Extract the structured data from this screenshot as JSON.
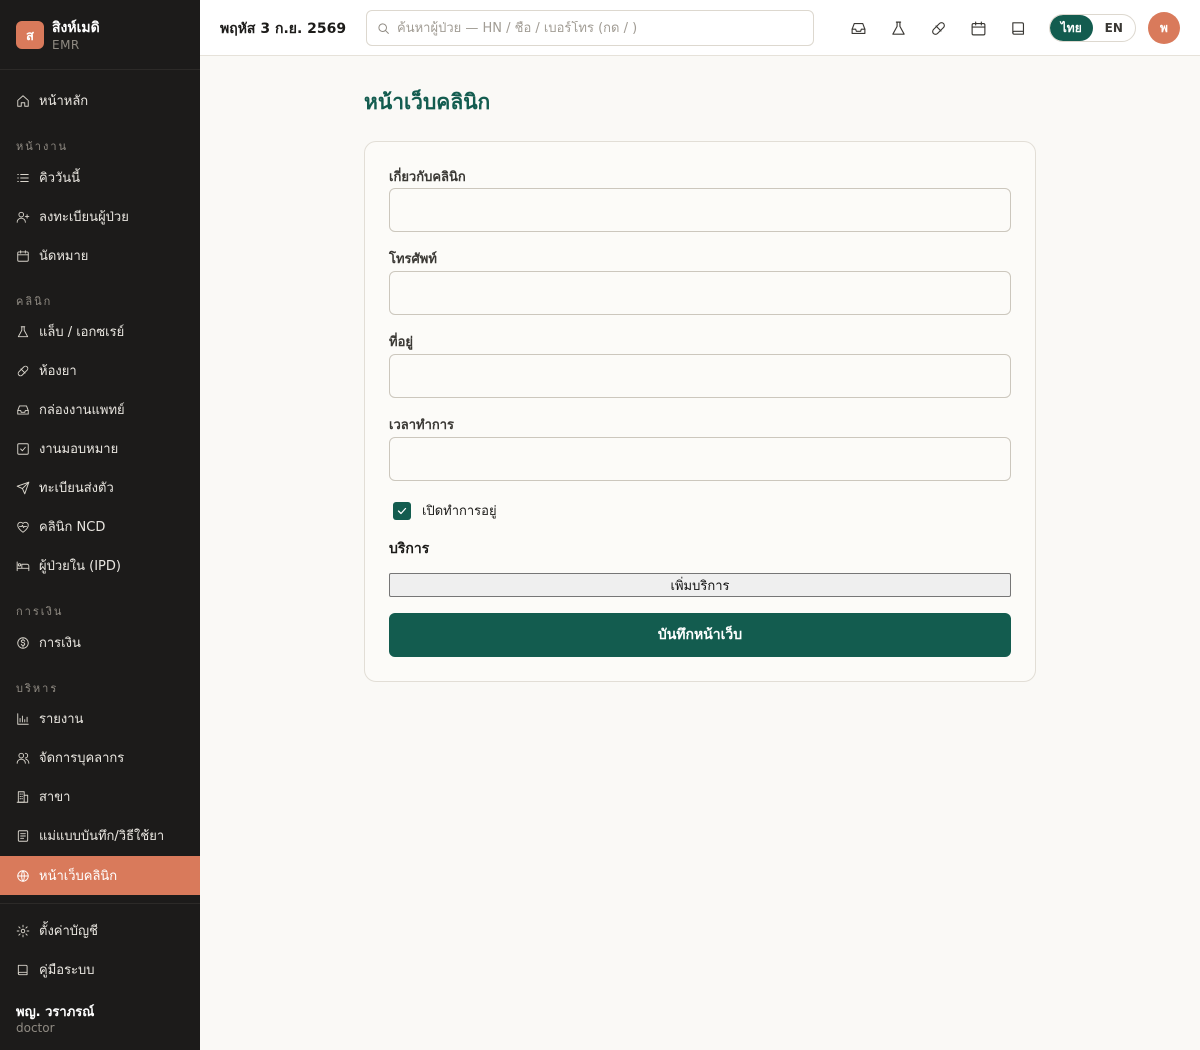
{
  "brand": {
    "logo_letter": "ส",
    "name": "สิงห์เมดิ",
    "subtitle": "EMR"
  },
  "sidebar": {
    "home": {
      "label": "หน้าหลัก",
      "icon": "home-icon"
    },
    "sections": [
      {
        "label": "หน้างาน",
        "items": [
          {
            "label": "คิววันนี้",
            "icon": "list-icon"
          },
          {
            "label": "ลงทะเบียนผู้ป่วย",
            "icon": "user-plus-icon"
          },
          {
            "label": "นัดหมาย",
            "icon": "calendar-icon"
          }
        ]
      },
      {
        "label": "คลินิก",
        "items": [
          {
            "label": "แล็บ / เอกซเรย์",
            "icon": "flask-icon"
          },
          {
            "label": "ห้องยา",
            "icon": "pill-icon"
          },
          {
            "label": "กล่องงานแพทย์",
            "icon": "inbox-icon"
          },
          {
            "label": "งานมอบหมาย",
            "icon": "check-square-icon"
          },
          {
            "label": "ทะเบียนส่งตัว",
            "icon": "send-icon"
          },
          {
            "label": "คลินิก NCD",
            "icon": "heart-pulse-icon"
          },
          {
            "label": "ผู้ป่วยใน (IPD)",
            "icon": "bed-icon"
          }
        ]
      },
      {
        "label": "การเงิน",
        "items": [
          {
            "label": "การเงิน",
            "icon": "dollar-circle-icon"
          }
        ]
      },
      {
        "label": "บริหาร",
        "items": [
          {
            "label": "รายงาน",
            "icon": "bar-chart-icon"
          },
          {
            "label": "จัดการบุคลากร",
            "icon": "users-icon"
          },
          {
            "label": "สาขา",
            "icon": "building-icon"
          },
          {
            "label": "แม่แบบบันทึก/วิธีใช้ยา",
            "icon": "file-text-icon"
          },
          {
            "label": "หน้าเว็บคลินิก",
            "icon": "globe-icon",
            "active": true
          }
        ]
      }
    ],
    "bottom": [
      {
        "label": "ตั้งค่าบัญชี",
        "icon": "gear-icon"
      },
      {
        "label": "คู่มือระบบ",
        "icon": "book-icon"
      }
    ],
    "user": {
      "name": "พญ. วราภรณ์",
      "role": "doctor"
    }
  },
  "topbar": {
    "date": "พฤหัส 3 ก.ย. 2569",
    "search_placeholder": "ค้นหาผู้ป่วย — HN / ชื่อ / เบอร์โทร (กด / )",
    "icons": [
      "inbox-icon",
      "flask-icon",
      "pill-icon",
      "calendar-icon",
      "book-icon"
    ],
    "lang": {
      "active": "ไทย",
      "other": "EN"
    },
    "avatar_letter": "พ"
  },
  "main": {
    "title": "หน้าเว็บคลินิก",
    "form": {
      "about_label": "เกี่ยวกับคลินิก",
      "about_value": "",
      "phone_label": "โทรศัพท์",
      "phone_value": "",
      "address_label": "ที่อยู่",
      "address_value": "",
      "hours_label": "เวลาทำการ",
      "hours_value": "",
      "open_label": "เปิดทำการอยู่",
      "open_checked": true,
      "services_heading": "บริการ",
      "add_service_label": "เพิ่มบริการ",
      "save_label": "บันทึกหน้าเว็บ"
    }
  },
  "colors": {
    "primary": "#135c4f",
    "accent": "#d97a5b",
    "sidebar_bg": "#1c1b1a"
  }
}
